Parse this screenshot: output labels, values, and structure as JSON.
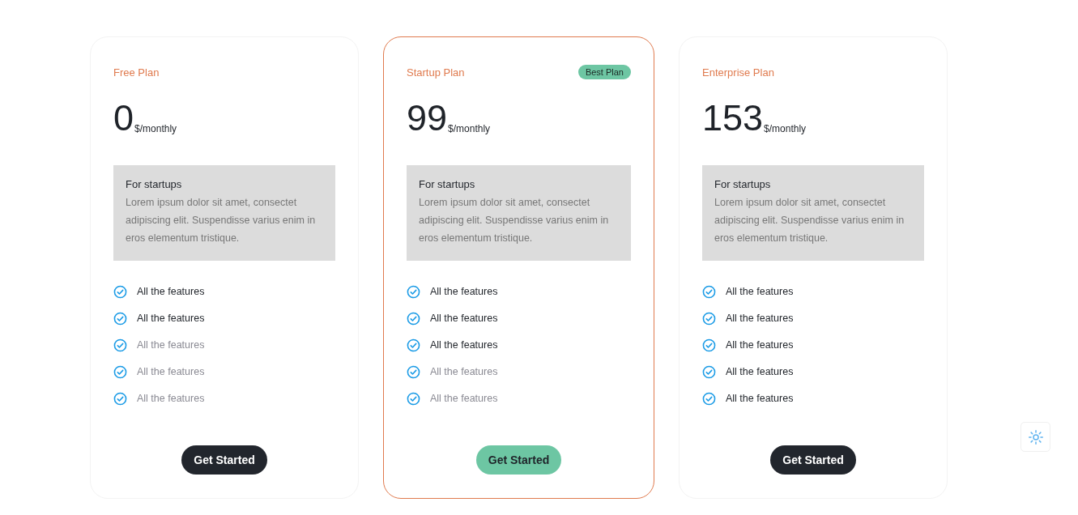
{
  "plans": [
    {
      "name": "Free Plan",
      "highlighted": false,
      "price": "0",
      "period": "$/monthly",
      "box_title": "For startups",
      "box_text": "Lorem ipsum dolor sit amet, consectet adipiscing elit. Suspendisse varius enim in eros elementum tristique.",
      "features": [
        {
          "label": "All the features",
          "included": true
        },
        {
          "label": "All the features",
          "included": true
        },
        {
          "label": "All the features",
          "included": false
        },
        {
          "label": "All the features",
          "included": false
        },
        {
          "label": "All the features",
          "included": false
        }
      ],
      "button": "Get Started"
    },
    {
      "name": "Startup Plan",
      "badge": "Best Plan",
      "highlighted": true,
      "price": "99",
      "period": "$/monthly",
      "box_title": "For startups",
      "box_text": "Lorem ipsum dolor sit amet, consectet adipiscing elit. Suspendisse varius enim in eros elementum tristique.",
      "features": [
        {
          "label": "All the features",
          "included": true
        },
        {
          "label": "All the features",
          "included": true
        },
        {
          "label": "All the features",
          "included": true
        },
        {
          "label": "All the features",
          "included": false
        },
        {
          "label": "All the features",
          "included": false
        }
      ],
      "button": "Get Started"
    },
    {
      "name": "Enterprise Plan",
      "highlighted": false,
      "price": "153",
      "period": "$/monthly",
      "box_title": "For startups",
      "box_text": "Lorem ipsum dolor sit amet, consectet adipiscing elit. Suspendisse varius enim in eros elementum tristique.",
      "features": [
        {
          "label": "All the features",
          "included": true
        },
        {
          "label": "All the features",
          "included": true
        },
        {
          "label": "All the features",
          "included": true
        },
        {
          "label": "All the features",
          "included": true
        },
        {
          "label": "All the features",
          "included": true
        }
      ],
      "button": "Get Started"
    }
  ]
}
